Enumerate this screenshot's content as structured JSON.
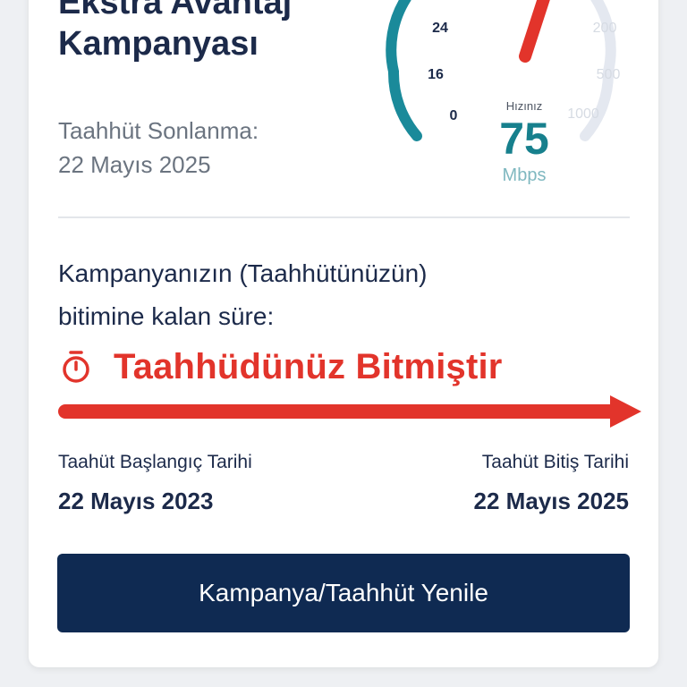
{
  "campaign": {
    "title_line1": "Ekstra Avantaj",
    "title_line2": "Kampanyası",
    "commitment_end_label": "Taahhüt Sonlanma:",
    "commitment_end_date": "22 Mayıs 2025"
  },
  "speed_gauge": {
    "left_ticks": [
      "24",
      "16",
      "0"
    ],
    "right_ticks": [
      "200",
      "500",
      "1000"
    ],
    "caption": "Hızınız",
    "value": "75",
    "unit": "Mbps",
    "colors": {
      "active_arc": "#1a8a9a",
      "inactive_arc": "#e4e8f0",
      "needle": "#e2342b",
      "value": "#17808d",
      "unit": "#7fb8c0"
    }
  },
  "remaining": {
    "label_line1": "Kampanyanızın (Taahhütünüzün)",
    "label_line2": "bitimine kalan süre:",
    "status_icon": "stopwatch-icon",
    "status_text": "Taahhüdünüz Bitmiştir",
    "progress_percent": 100,
    "accent_color": "#e2342b"
  },
  "dates": {
    "start_label": "Taahüt Başlangıç Tarihi",
    "start_date": "22 Mayıs 2023",
    "end_label": "Taahüt Bitiş Tarihi",
    "end_date": "22 Mayıs 2025"
  },
  "actions": {
    "renew_label": "Kampanya/Taahhüt Yenile"
  }
}
